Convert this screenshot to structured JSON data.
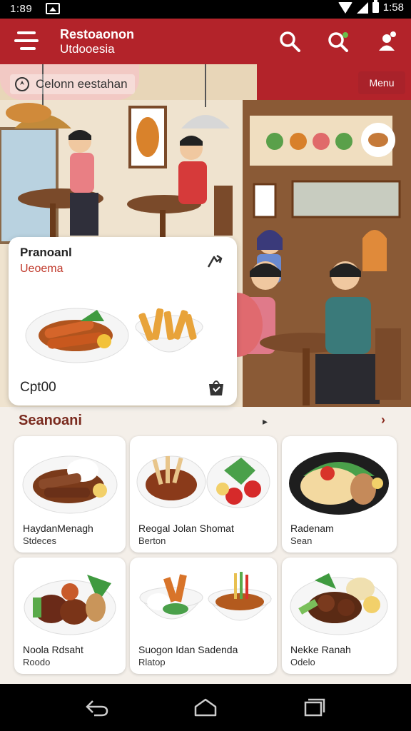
{
  "status_bar": {
    "time": "1:89",
    "time_right": "1:58"
  },
  "app_bar": {
    "title": "Restoaonon",
    "subtitle": "Utdooesia"
  },
  "hero": {
    "location_label": "Celonn eestahan",
    "menu_label": "Menu"
  },
  "featured": {
    "title": "Pranoanl",
    "subtitle": "Ueoema",
    "price": "Cpt00"
  },
  "section": {
    "title": "Seanoani"
  },
  "dishes": [
    {
      "name": "HaydanMenagh",
      "desc": "Stdeces"
    },
    {
      "name": "Reogal Jolan Shomat",
      "desc": "Berton"
    },
    {
      "name": "Radenam",
      "desc": "Sean"
    },
    {
      "name": "Noola Rdsaht",
      "desc": "Roodo"
    },
    {
      "name": "Suogon Idan Sadenda",
      "desc": "Rlatop"
    },
    {
      "name": "Nekke Ranah",
      "desc": "Odelo"
    }
  ],
  "colors": {
    "brand_red": "#b3232a",
    "title_brown": "#7a2a1e",
    "page_bg": "#f4efe9"
  },
  "icons": [
    "menu-icon",
    "search-icon",
    "search-filter-icon",
    "profile-icon",
    "location-icon",
    "share-icon",
    "cart-icon",
    "back-icon",
    "home-icon",
    "recents-icon"
  ]
}
